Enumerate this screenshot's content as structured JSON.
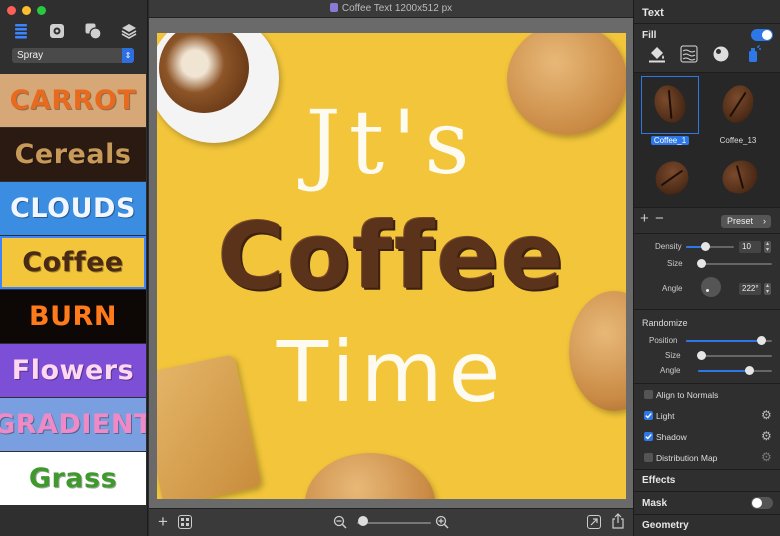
{
  "window": {
    "title": "Coffee Text 1200x512 px"
  },
  "sidebar": {
    "dropdown_value": "Spray",
    "toolbar_icons": [
      "list-icon",
      "gear-icon",
      "shapes-icon",
      "layers-icon"
    ],
    "styles": [
      {
        "label": "CARROT",
        "bg": "#d7a877",
        "fg": "#e86a1f"
      },
      {
        "label": "Cereals",
        "bg": "#2a1a12",
        "fg": "#c89a5a"
      },
      {
        "label": "CLOUDS",
        "bg": "#3a8de0",
        "fg": "#f1f6ff"
      },
      {
        "label": "Coffee",
        "bg": "#f2c53a",
        "fg": "#4a2a15"
      },
      {
        "label": "BURN",
        "bg": "#0d0805",
        "fg": "#ff7a1a"
      },
      {
        "label": "Flowers",
        "bg": "#7c4fd6",
        "fg": "#ffd7f0"
      },
      {
        "label": "GRADIENT",
        "bg": "#7a9fe0",
        "fg": "#f08ac6"
      },
      {
        "label": "Grass",
        "bg": "#ffffff",
        "fg": "#3d9a2b"
      }
    ]
  },
  "canvas": {
    "line1": "Jt's",
    "line2": "Coffee",
    "line3": "Time"
  },
  "bottombar": {
    "zoom_level": 0.0
  },
  "panel": {
    "text_heading": "Text",
    "fill_label": "Fill",
    "fill_on": true,
    "fill_icons": [
      "paint-bucket-icon",
      "waves-icon",
      "sphere-icon",
      "spray-icon"
    ],
    "presets": [
      {
        "label": "Coffee_1",
        "selected": true
      },
      {
        "label": "Coffee_13",
        "selected": false
      },
      {
        "label": "",
        "selected": false
      },
      {
        "label": "",
        "selected": false
      }
    ],
    "preset_button": "Preset",
    "density_label": "Density",
    "density_value": "10",
    "density_level": 0.4,
    "size_label": "Size",
    "size_level": 0.05,
    "angle_label": "Angle",
    "angle_value": "222°",
    "randomize_heading": "Randomize",
    "rand_position_label": "Position",
    "rand_position_level": 0.88,
    "rand_size_label": "Size",
    "rand_size_level": 0.05,
    "rand_angle_label": "Angle",
    "rand_angle_level": 0.7,
    "align_normals_label": "Align to Normals",
    "align_normals_checked": false,
    "light_label": "Light",
    "light_checked": true,
    "shadow_label": "Shadow",
    "shadow_checked": true,
    "distribution_label": "Distribution Map",
    "distribution_checked": false,
    "effects_heading": "Effects",
    "mask_heading": "Mask",
    "mask_on": false,
    "geometry_heading": "Geometry",
    "accent": "#2d77e6"
  }
}
